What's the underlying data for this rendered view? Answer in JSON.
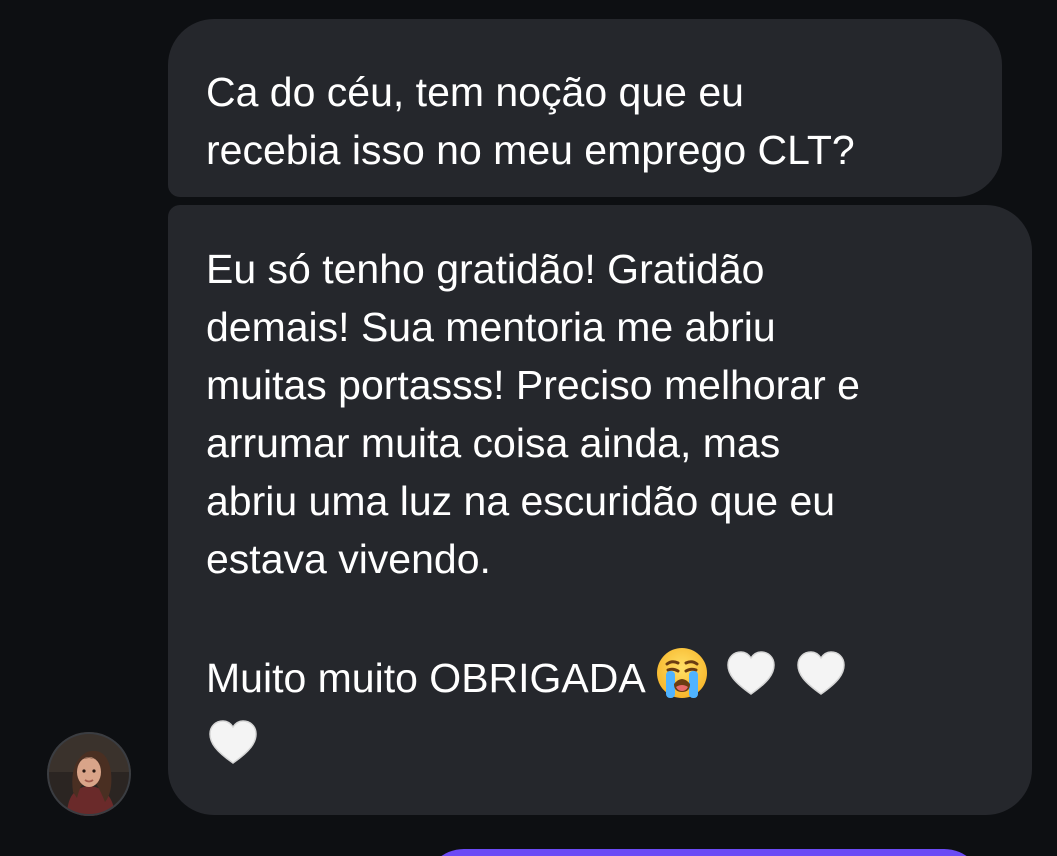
{
  "messages": [
    {
      "sender": "self",
      "lines": [
        "Ca do céu, tem noção que eu",
        "recebia isso no meu emprego CLT?"
      ]
    },
    {
      "sender": "contact",
      "lines": [
        "Eu só tenho gratidão! Gratidão",
        "demais! Sua mentoria me abriu",
        "muitas portasss! Preciso melhorar e",
        "arrumar muita coisa ainda, mas",
        "abriu uma luz na escuridão que eu",
        "estava vivendo."
      ],
      "closing": "Muito muito OBRIGADA",
      "emojis": [
        "loudly-crying-face-icon",
        "white-heart-icon",
        "white-heart-icon",
        "white-heart-icon"
      ]
    }
  ],
  "colors": {
    "background": "#0d0f12",
    "bubble": "#25272c",
    "text": "#ffffff",
    "accent": "#6b4bf5"
  }
}
